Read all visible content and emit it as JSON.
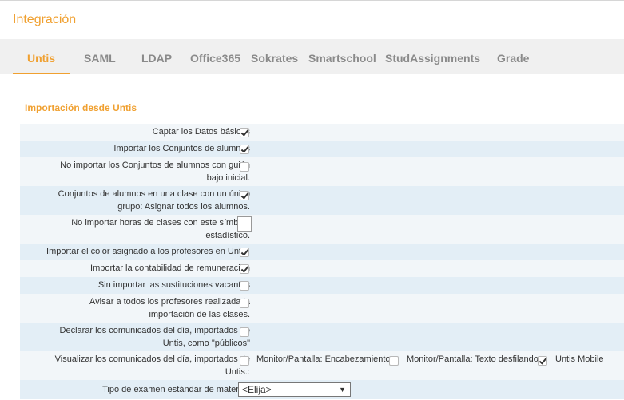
{
  "header": {
    "title": "Integración"
  },
  "tabs": [
    {
      "label": "Untis"
    },
    {
      "label": "SAML"
    },
    {
      "label": "LDAP"
    },
    {
      "label": "Office365"
    },
    {
      "label": "Sokrates"
    },
    {
      "label": "Smartschool"
    },
    {
      "label": "StudAssignments"
    },
    {
      "label": "Grade"
    }
  ],
  "section": {
    "title": "Importación desde Untis"
  },
  "rows": [
    {
      "label_lines": [
        "Captar los Datos básicos"
      ],
      "checked": true
    },
    {
      "label_lines": [
        "Importar los Conjuntos de alumnos"
      ],
      "checked": true
    },
    {
      "label_lines": [
        "No importar los Conjuntos de alumnos con guión",
        "bajo inicial."
      ],
      "checked": false
    },
    {
      "label_lines": [
        "Conjuntos de alumnos en una clase con un único",
        "grupo: Asignar todos los alumnos."
      ],
      "checked": true
    },
    {
      "label_lines": [
        "No importar horas de clases con este símbolo",
        "estadístico."
      ],
      "value": ""
    },
    {
      "label_lines": [
        "Importar el color asignado a los profesores en Untis."
      ],
      "checked": true
    },
    {
      "label_lines": [
        "Importar la contabilidad de remuneración"
      ],
      "checked": true
    },
    {
      "label_lines": [
        "Sin importar las sustituciones vacantes"
      ],
      "checked": false
    },
    {
      "label_lines": [
        "Avisar a todos los profesores realizada la",
        "importación de las clases."
      ],
      "checked": false
    },
    {
      "label_lines": [
        "Declarar los comunicados del día, importados de",
        "Untis, como \"públicos\""
      ],
      "checked": false
    },
    {
      "label_lines": [
        "Visualizar los comunicados del día, importados de",
        "Untis.:"
      ],
      "options": [
        {
          "label": "Monitor/Pantalla: Encabezamiento",
          "checked": false
        },
        {
          "label": "Monitor/Pantalla: Texto desfilando",
          "checked": false
        },
        {
          "label": "Untis Mobile",
          "checked": true
        }
      ]
    },
    {
      "label_lines": [
        "Tipo de examen estándar de materias"
      ],
      "select_value": "<Elija>",
      "arrow": "▼"
    }
  ]
}
